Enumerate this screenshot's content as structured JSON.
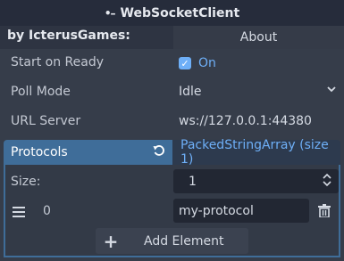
{
  "title_bar": {
    "title": "WebSocketClient",
    "icon": "node-connection-icon"
  },
  "about": {
    "author_label": "by IcterusGames:",
    "button_label": "About"
  },
  "properties": {
    "start_on_ready": {
      "label": "Start on Ready",
      "checked": true,
      "value_label": "On"
    },
    "poll_mode": {
      "label": "Poll Mode",
      "value": "Idle"
    },
    "url_server": {
      "label": "URL Server",
      "value": "ws://127.0.0.1:44380"
    }
  },
  "protocols": {
    "label": "Protocols",
    "type_label": "PackedStringArray (size 1)",
    "size_label": "Size:",
    "size_value": "1",
    "elements": [
      {
        "index": "0",
        "value": "my-protocol"
      }
    ],
    "add_label": "Add Element"
  },
  "colors": {
    "accent": "#6eaff7",
    "header_selected": "#3f6d99",
    "background": "#363d4a"
  }
}
